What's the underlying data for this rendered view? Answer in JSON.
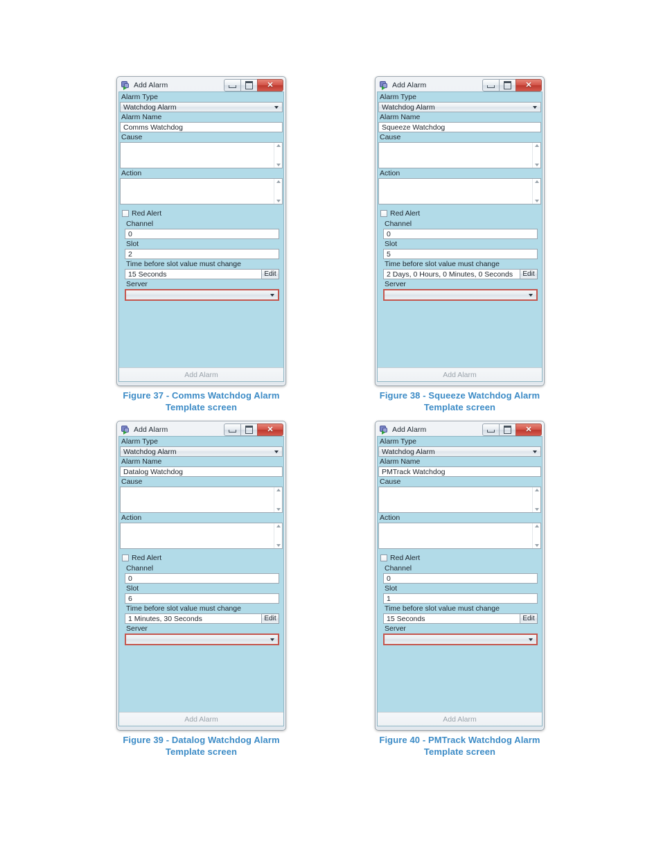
{
  "window": {
    "title": "Add Alarm",
    "icon": "gear-arrow-icon",
    "buttons": {
      "minimize": "minimize-icon",
      "maximize": "maximize-icon",
      "close": "✕"
    }
  },
  "labels": {
    "alarm_type": "Alarm Type",
    "alarm_name": "Alarm Name",
    "cause": "Cause",
    "action": "Action",
    "red_alert": "Red Alert",
    "channel": "Channel",
    "slot": "Slot",
    "time_before": "Time before slot value must change",
    "server": "Server",
    "edit": "Edit",
    "add_alarm": "Add Alarm"
  },
  "colors": {
    "panel_background": "#b2dbe8",
    "caption_text": "#3c8bc6",
    "error_border": "#c4564e",
    "close_button": "#d4554a"
  },
  "figures": [
    {
      "id": "figure-1",
      "caption_line1": "Figure 37 - Comms Watchdog Alarm",
      "caption_line2": "Template screen",
      "form": {
        "alarm_type": "Watchdog Alarm",
        "alarm_name": "Comms Watchdog",
        "cause": "",
        "action": "",
        "red_alert_checked": false,
        "channel": "0",
        "slot": "2",
        "time_before": "15 Seconds",
        "server": ""
      }
    },
    {
      "id": "figure-2",
      "caption_line1": "Figure 38 - Squeeze Watchdog Alarm",
      "caption_line2": "Template screen",
      "form": {
        "alarm_type": "Watchdog Alarm",
        "alarm_name": "Squeeze Watchdog",
        "cause": "",
        "action": "",
        "red_alert_checked": false,
        "channel": "0",
        "slot": "5",
        "time_before": "2 Days, 0 Hours, 0 Minutes, 0 Seconds",
        "server": ""
      }
    },
    {
      "id": "figure-3",
      "caption_line1": "Figure 39 - Datalog Watchdog Alarm",
      "caption_line2": "Template screen",
      "form": {
        "alarm_type": "Watchdog Alarm",
        "alarm_name": "Datalog Watchdog",
        "cause": "",
        "action": "",
        "red_alert_checked": false,
        "channel": "0",
        "slot": "6",
        "time_before": "1 Minutes, 30 Seconds",
        "server": ""
      }
    },
    {
      "id": "figure-4",
      "caption_line1": "Figure 40 - PMTrack Watchdog Alarm",
      "caption_line2": "Template screen",
      "form": {
        "alarm_type": "Watchdog Alarm",
        "alarm_name": "PMTrack Watchdog",
        "cause": "",
        "action": "",
        "red_alert_checked": false,
        "channel": "0",
        "slot": "1",
        "time_before": "15 Seconds",
        "server": ""
      }
    }
  ]
}
